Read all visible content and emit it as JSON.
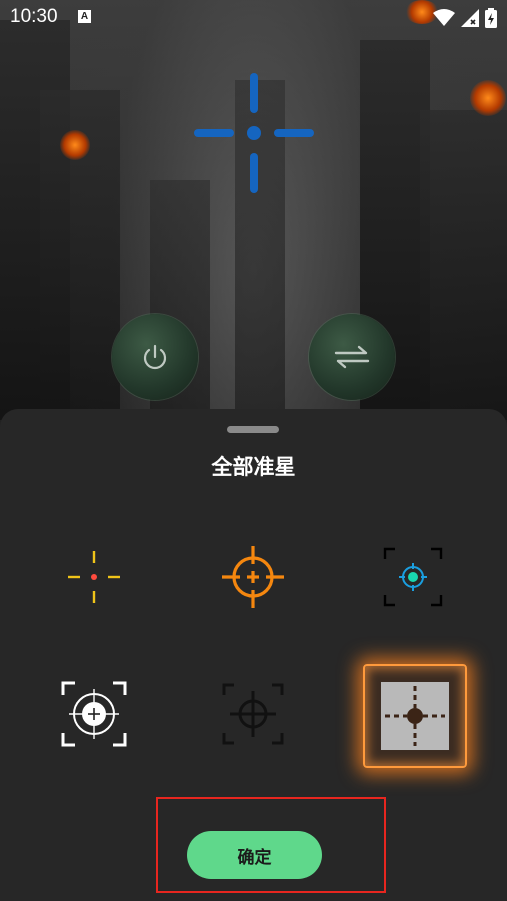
{
  "status_bar": {
    "time": "10:30",
    "notification_icon": "a-icon",
    "icons": [
      "wifi-icon",
      "signal-icon",
      "battery-icon"
    ]
  },
  "main": {
    "crosshair_icon": "crosshair-icon",
    "power_button_icon": "power-icon",
    "switch_button_icon": "swap-icon",
    "crosshair_color": "#1565c0"
  },
  "sheet": {
    "title": "全部准星",
    "crosshairs": [
      {
        "icon": "dot-cross-crosshair-icon",
        "selected": false
      },
      {
        "icon": "orange-ring-crosshair-icon",
        "selected": false
      },
      {
        "icon": "teal-bracket-crosshair-icon",
        "selected": false
      },
      {
        "icon": "white-bracket-crosshair-icon",
        "selected": false
      },
      {
        "icon": "dark-bracket-crosshair-icon",
        "selected": false
      },
      {
        "icon": "square-dot-crosshair-icon",
        "selected": true
      }
    ],
    "confirm_label": "确定",
    "accent_color": "#5fd88b",
    "selected_glow_color": "#ff9a3c"
  }
}
